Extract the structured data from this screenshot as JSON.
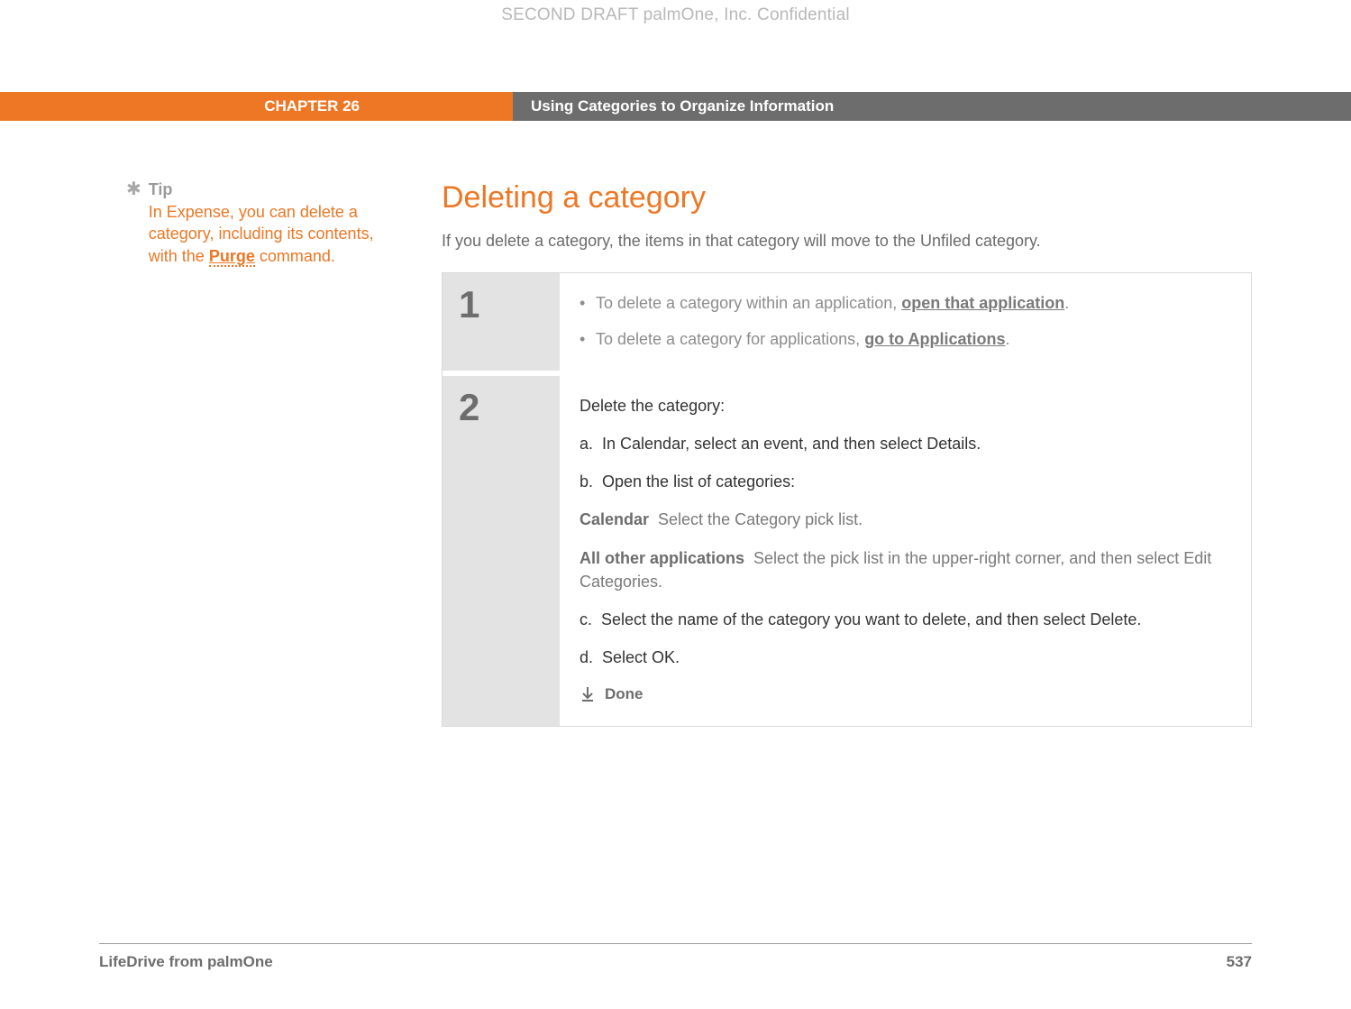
{
  "watermark": "SECOND DRAFT palmOne, Inc.  Confidential",
  "chapter": {
    "label": "CHAPTER 26",
    "title": "Using Categories to Organize Information"
  },
  "sidebar": {
    "tip_label": "Tip",
    "tip_text_before": "In Expense, you can delete a category, including its contents, with the ",
    "tip_link": "Purge",
    "tip_text_after": " command."
  },
  "main": {
    "title": "Deleting a category",
    "intro": "If you delete a category, the items in that category will move to the Unfiled category."
  },
  "steps": [
    {
      "number": "1",
      "bullets": [
        {
          "before": "To delete a category within an application, ",
          "link": "open that application",
          "after": "."
        },
        {
          "before": "To delete a category for applications, ",
          "link": "go to Applications",
          "after": "."
        }
      ]
    },
    {
      "number": "2",
      "heading": "Delete the category:",
      "substeps": {
        "a": "In Calendar, select an event, and then select Details.",
        "b": "Open the list of categories:",
        "c": "Select the name of the category you want to delete, and then select Delete.",
        "d": "Select OK."
      },
      "defs": [
        {
          "label": "Calendar",
          "text": "Select the Category pick list."
        },
        {
          "label": "All other applications",
          "text": "Select the pick list in the upper-right corner, and then select Edit Categories."
        }
      ],
      "done": "Done"
    }
  ],
  "footer": {
    "product": "LifeDrive from palmOne",
    "page": "537"
  }
}
